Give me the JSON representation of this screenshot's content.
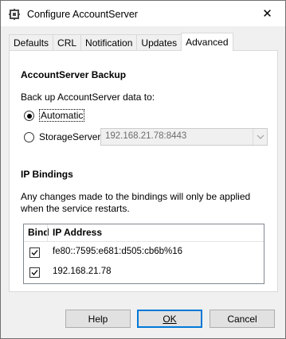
{
  "window": {
    "title": "Configure AccountServer",
    "close_glyph": "✕"
  },
  "tabs": [
    {
      "label": "Defaults",
      "active": false
    },
    {
      "label": "CRL",
      "active": false
    },
    {
      "label": "Notification",
      "active": false
    },
    {
      "label": "Updates",
      "active": false
    },
    {
      "label": "Advanced",
      "active": true
    }
  ],
  "backup": {
    "heading": "AccountServer Backup",
    "prompt": "Back up AccountServer data to:",
    "option_automatic": "Automatic",
    "option_storage": "StorageServer:",
    "selected": "Automatic",
    "storage_value": "192.168.21.78:8443"
  },
  "bindings": {
    "heading": "IP Bindings",
    "note": "Any changes made to the bindings will only be applied when the service restarts.",
    "columns": [
      "Bind",
      "IP Address"
    ],
    "rows": [
      {
        "bind": true,
        "address": "fe80::7595:e681:d505:cb6b%16"
      },
      {
        "bind": true,
        "address": "192.168.21.78"
      }
    ]
  },
  "buttons": {
    "help": "Help",
    "ok": "OK",
    "cancel": "Cancel"
  },
  "colors": {
    "accent": "#0078d7",
    "window_bg": "#f0f0f0"
  },
  "icons": {
    "app": "app-icon",
    "close": "close-icon",
    "combo_arrow": "chevron-down-icon",
    "check": "check-icon"
  }
}
